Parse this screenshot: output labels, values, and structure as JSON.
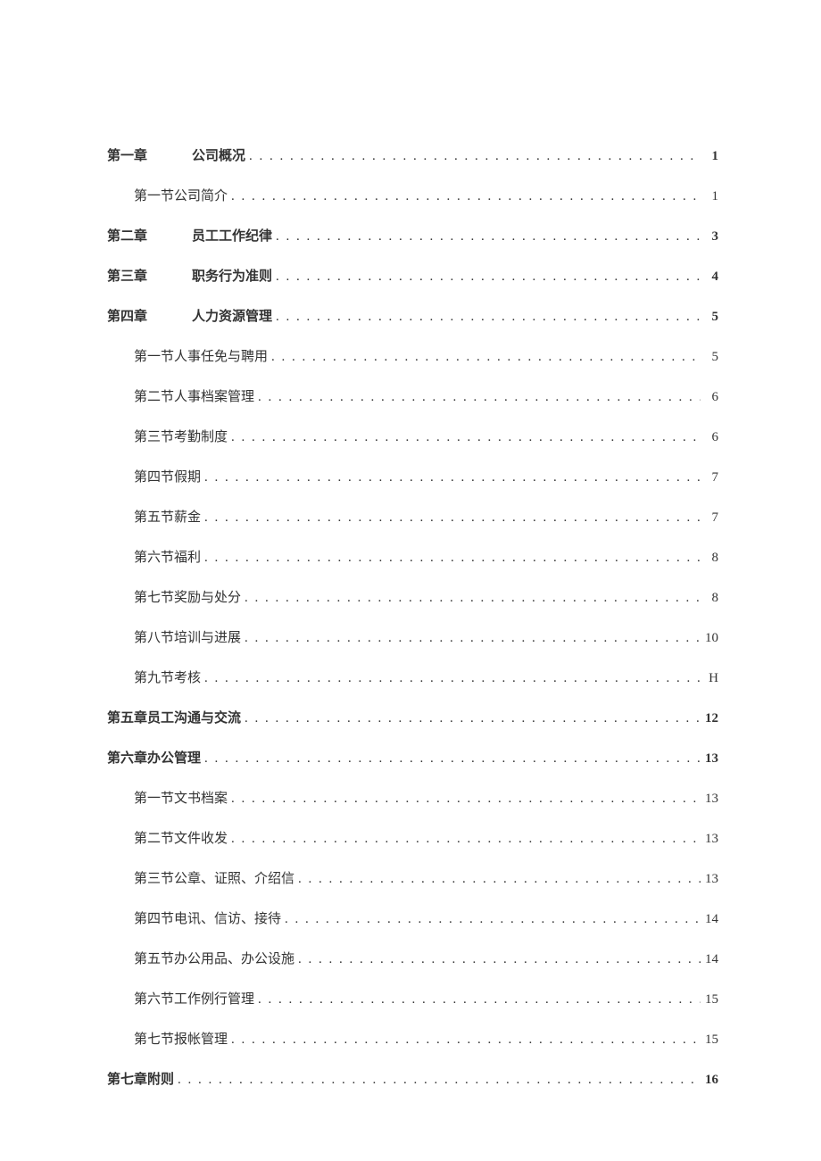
{
  "toc": [
    {
      "level": 0,
      "chapter": "第一章",
      "gap": true,
      "title": "公司概况",
      "page": "1",
      "bold": true
    },
    {
      "level": 1,
      "chapter": "",
      "gap": false,
      "title": "第一节公司简介",
      "page": "1",
      "bold": false
    },
    {
      "level": 0,
      "chapter": "第二章",
      "gap": true,
      "title": "员工工作纪律",
      "page": "3",
      "bold": true
    },
    {
      "level": 0,
      "chapter": "第三章",
      "gap": true,
      "title": "职务行为准则",
      "page": "4",
      "bold": true
    },
    {
      "level": 0,
      "chapter": "第四章",
      "gap": true,
      "title": "人力资源管理",
      "page": "5",
      "bold": true
    },
    {
      "level": 1,
      "chapter": "",
      "gap": false,
      "title": "第一节人事任免与聘用",
      "page": "5",
      "bold": false
    },
    {
      "level": 1,
      "chapter": "",
      "gap": false,
      "title": "第二节人事档案管理",
      "page": "6",
      "bold": false
    },
    {
      "level": 1,
      "chapter": "",
      "gap": false,
      "title": "第三节考勤制度",
      "page": "6",
      "bold": false
    },
    {
      "level": 1,
      "chapter": "",
      "gap": false,
      "title": "第四节假期",
      "page": "7",
      "bold": false
    },
    {
      "level": 1,
      "chapter": "",
      "gap": false,
      "title": "第五节薪金",
      "page": "7",
      "bold": false
    },
    {
      "level": 1,
      "chapter": "",
      "gap": false,
      "title": "第六节福利",
      "page": "8",
      "bold": false
    },
    {
      "level": 1,
      "chapter": "",
      "gap": false,
      "title": "第七节奖励与处分",
      "page": "8",
      "bold": false
    },
    {
      "level": 1,
      "chapter": "",
      "gap": false,
      "title": "第八节培训与进展",
      "page": "10",
      "bold": false
    },
    {
      "level": 1,
      "chapter": "",
      "gap": false,
      "title": "第九节考核",
      "page": "H",
      "bold": false
    },
    {
      "level": 0,
      "chapter": "",
      "gap": false,
      "title": "第五章员工沟通与交流",
      "page": "12",
      "bold": true
    },
    {
      "level": 0,
      "chapter": "",
      "gap": false,
      "title": "第六章办公管理",
      "page": "13",
      "bold": true
    },
    {
      "level": 1,
      "chapter": "",
      "gap": false,
      "title": "第一节文书档案",
      "page": "13",
      "bold": false
    },
    {
      "level": 1,
      "chapter": "",
      "gap": false,
      "title": "第二节文件收发",
      "page": "13",
      "bold": false
    },
    {
      "level": 1,
      "chapter": "",
      "gap": false,
      "title": "第三节公章、证照、介绍信",
      "page": "13",
      "bold": false
    },
    {
      "level": 1,
      "chapter": "",
      "gap": false,
      "title": "第四节电讯、信访、接待",
      "page": "14",
      "bold": false
    },
    {
      "level": 1,
      "chapter": "",
      "gap": false,
      "title": "第五节办公用品、办公设施",
      "page": "14",
      "bold": false
    },
    {
      "level": 1,
      "chapter": "",
      "gap": false,
      "title": "第六节工作例行管理",
      "page": "15",
      "bold": false
    },
    {
      "level": 1,
      "chapter": "",
      "gap": false,
      "title": "第七节报帐管理",
      "page": "15",
      "bold": false
    },
    {
      "level": 0,
      "chapter": "",
      "gap": false,
      "title": "第七章附则",
      "page": "16",
      "bold": true
    }
  ]
}
